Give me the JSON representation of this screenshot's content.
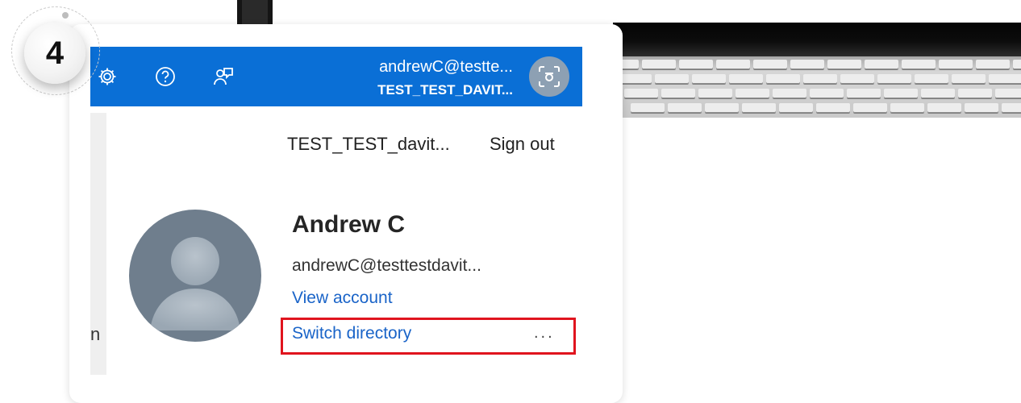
{
  "step": {
    "number": "4"
  },
  "header": {
    "icons": [
      "gear-icon",
      "help-icon",
      "feedback-icon"
    ],
    "account_email": "andrewC@testte...",
    "account_tenant": "TEST_TEST_DAVIT...",
    "accent_color": "#0a6fd6"
  },
  "account_panel": {
    "tenant_name": "TEST_TEST_davit...",
    "sign_out_label": "Sign out",
    "user_name": "Andrew C",
    "user_email": "andrewC@testtestdavit...",
    "view_account_label": "View account",
    "switch_directory_label": "Switch directory",
    "more_label": "...",
    "highlight_color": "#e0141e"
  },
  "side_fragment": {
    "text": "n"
  }
}
